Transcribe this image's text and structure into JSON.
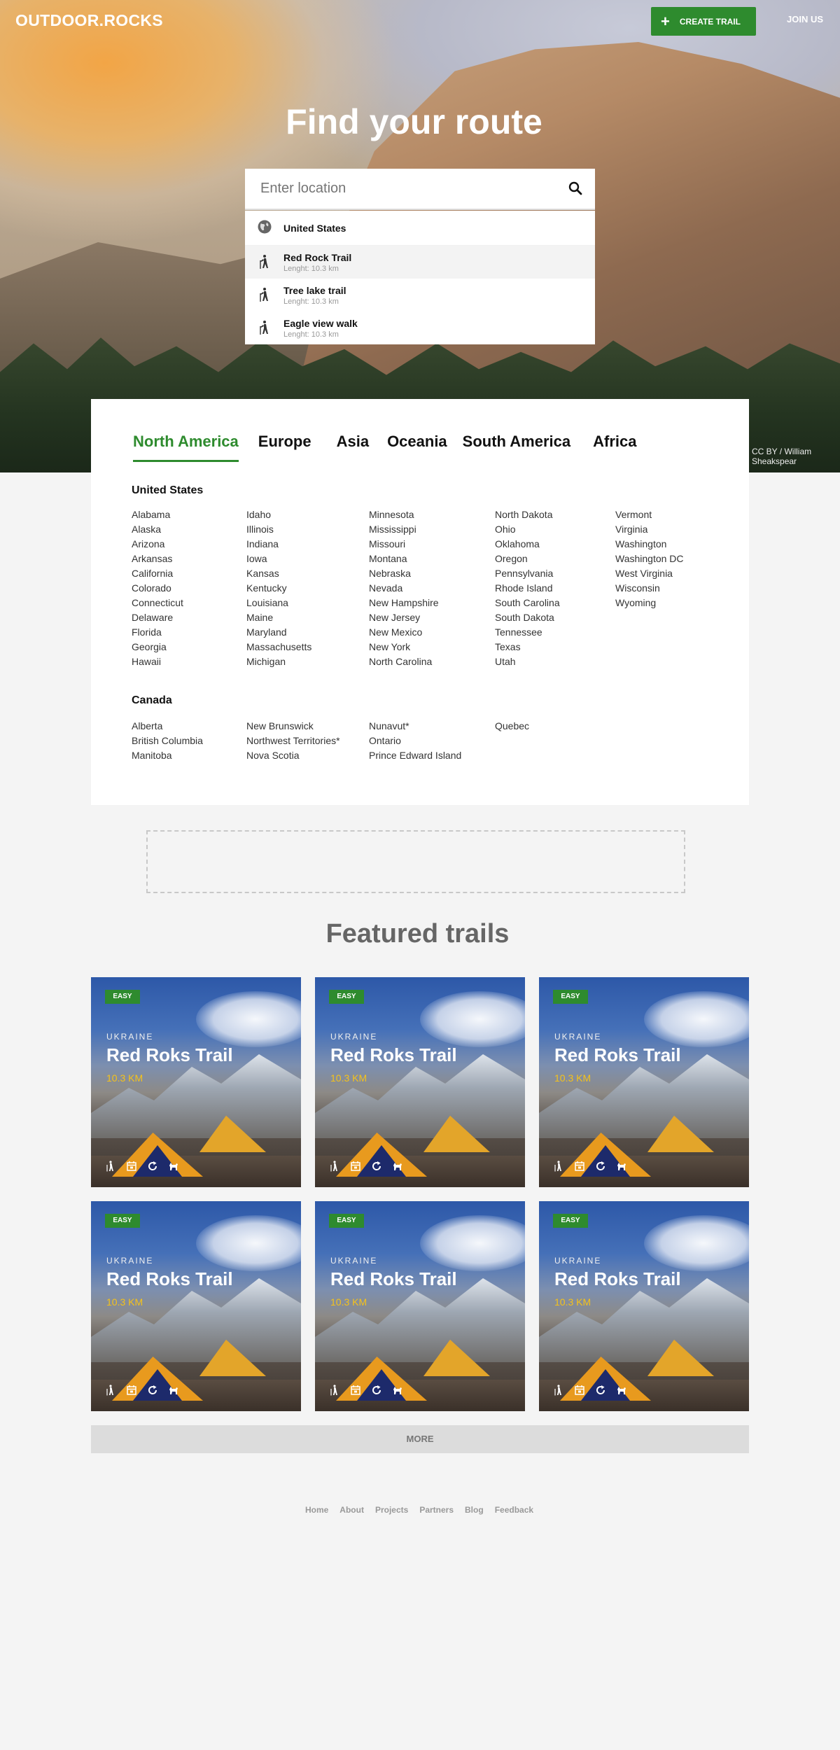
{
  "header": {
    "logo": "OUTDOOR.ROCKS",
    "create_trail_label": "CREATE TRAIL",
    "join_label": "JOIN US"
  },
  "hero": {
    "title": "Find your route",
    "search_placeholder": "Enter location",
    "photo_credit": "CC BY / William Sheakspear"
  },
  "dropdown": {
    "country": "United States",
    "trails": [
      {
        "title": "Red Rock Trail",
        "sub": "Lenght: 10.3 km"
      },
      {
        "title": "Tree lake trail",
        "sub": "Lenght: 10.3 km"
      },
      {
        "title": "Eagle view walk",
        "sub": "Lenght: 10.3 km"
      }
    ]
  },
  "regions": {
    "tabs": [
      "North America",
      "Europe",
      "Asia",
      "Oceania",
      "South America",
      "Africa"
    ],
    "active_tab": "North America",
    "us": {
      "title": "United States",
      "columns": [
        [
          "Alabama",
          "Alaska",
          "Arizona",
          "Arkansas",
          "California",
          "Colorado",
          "Connecticut",
          "Delaware",
          "Florida",
          "Georgia",
          "Hawaii"
        ],
        [
          "Idaho",
          "Illinois",
          "Indiana",
          "Iowa",
          "Kansas",
          "Kentucky",
          "Louisiana",
          "Maine",
          "Maryland",
          "Massachusetts",
          "Michigan"
        ],
        [
          "Minnesota",
          "Mississippi",
          "Missouri",
          "Montana",
          "Nebraska",
          "Nevada",
          "New Hampshire",
          "New Jersey",
          "New Mexico",
          "New York",
          "North Carolina"
        ],
        [
          "North Dakota",
          "Ohio",
          "Oklahoma",
          "Oregon",
          "Pennsylvania",
          "Rhode Island",
          "South Carolina",
          "South Dakota",
          "Tennessee",
          "Texas",
          "Utah"
        ],
        [
          "Vermont",
          "Virginia",
          "Washington",
          "Washington DC",
          "West Virginia",
          "Wisconsin",
          "Wyoming"
        ]
      ]
    },
    "canada": {
      "title": "Canada",
      "columns": [
        [
          "Alberta",
          "British Columbia",
          "Manitoba"
        ],
        [
          "New Brunswick",
          "Northwest Territories*",
          "Nova Scotia"
        ],
        [
          "Nunavut*",
          "Ontario",
          "Prince Edward Island"
        ],
        [
          "Quebec"
        ]
      ]
    }
  },
  "featured": {
    "title": "Featured trails",
    "cards": [
      {
        "badge": "EASY",
        "country": "UKRAINE",
        "name": "Red Roks Trail",
        "length": "10.3 KM"
      },
      {
        "badge": "EASY",
        "country": "UKRAINE",
        "name": "Red Roks Trail",
        "length": "10.3 KM"
      },
      {
        "badge": "EASY",
        "country": "UKRAINE",
        "name": "Red Roks Trail",
        "length": "10.3 KM"
      },
      {
        "badge": "EASY",
        "country": "UKRAINE",
        "name": "Red Roks Trail",
        "length": "10.3 KM"
      },
      {
        "badge": "EASY",
        "country": "UKRAINE",
        "name": "Red Roks Trail",
        "length": "10.3 KM"
      },
      {
        "badge": "EASY",
        "country": "UKRAINE",
        "name": "Red Roks Trail",
        "length": "10.3 KM"
      }
    ],
    "card_icons": [
      "hiker-icon",
      "calendar-icon",
      "loop-icon",
      "dog-icon"
    ],
    "more_label": "MORE"
  },
  "footer": {
    "links": [
      "Home",
      "About",
      "Projects",
      "Partners",
      "Blog",
      "Feedback"
    ]
  },
  "colors": {
    "accent": "#2e8b2e",
    "length_highlight": "#f5c21a",
    "page_bg": "#f4f4f4"
  }
}
